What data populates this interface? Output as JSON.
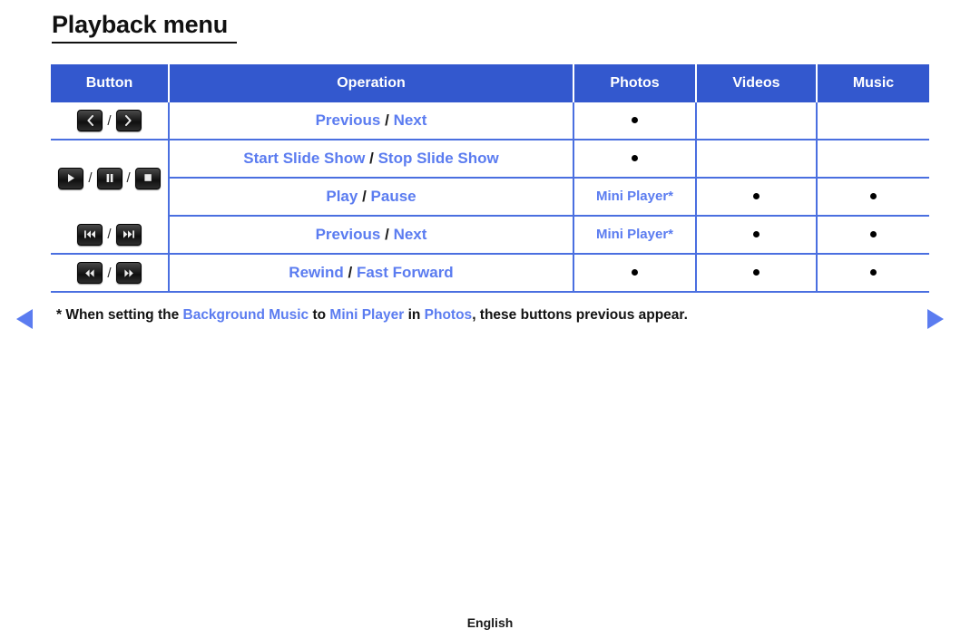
{
  "page": {
    "title": "Playback menu",
    "footer_language": "English"
  },
  "table": {
    "headers": {
      "button": "Button",
      "operation": "Operation",
      "photos": "Photos",
      "videos": "Videos",
      "music": "Music"
    },
    "rows": [
      {
        "buttons": [
          "prev-chevron-icon",
          "next-chevron-icon"
        ],
        "operation_parts": [
          "Previous",
          "Next"
        ],
        "separator": "/",
        "photos": "dot",
        "videos": "",
        "music": ""
      },
      {
        "buttons": [
          "play-icon",
          "pause-icon",
          "stop-icon"
        ],
        "operation_parts": [
          "Start Slide Show",
          "Stop Slide Show"
        ],
        "separator": "/",
        "photos": "dot",
        "videos": "",
        "music": ""
      },
      {
        "buttons": [],
        "operation_parts": [
          "Play",
          "Pause"
        ],
        "separator": "/",
        "photos": "Mini Player*",
        "videos": "dot",
        "music": "dot"
      },
      {
        "buttons": [
          "skip-back-icon",
          "skip-forward-icon"
        ],
        "operation_parts": [
          "Previous",
          "Next"
        ],
        "separator": "/",
        "photos": "Mini Player*",
        "videos": "dot",
        "music": "dot"
      },
      {
        "buttons": [
          "rewind-icon",
          "fast-forward-icon"
        ],
        "operation_parts": [
          "Rewind",
          "Fast Forward"
        ],
        "separator": "/",
        "photos": "dot",
        "videos": "dot",
        "music": "dot"
      }
    ]
  },
  "footnote": {
    "p1": "* When setting the ",
    "h1": "Background Music",
    "p2": " to ",
    "h2": "Mini Player",
    "p3": " in ",
    "h3": "Photos",
    "p4": ", these buttons previous appear."
  },
  "nav": {
    "prev_page": "previous-page-arrow",
    "next_page": "next-page-arrow"
  },
  "colors": {
    "header_blue": "#3358ce",
    "link_blue": "#5b7cf0",
    "grid_blue": "#4a6fe0"
  }
}
